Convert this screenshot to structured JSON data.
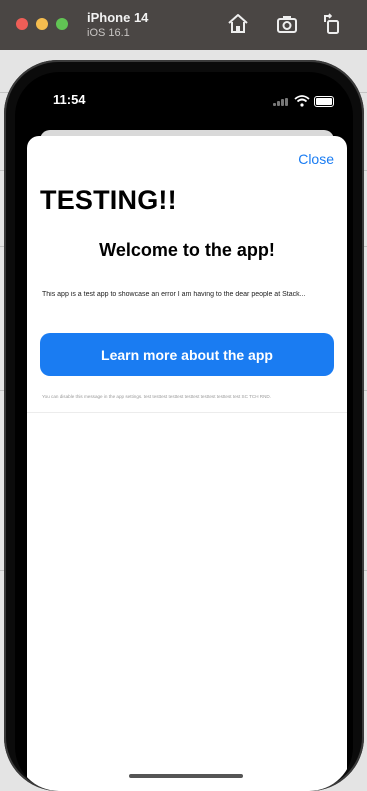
{
  "simulator": {
    "device_name": "iPhone 14",
    "os_version": "iOS 16.1",
    "toolbar_icons": [
      "home-icon",
      "screenshot-icon",
      "rotate-icon"
    ]
  },
  "status_bar": {
    "time": "11:54",
    "icons": [
      "signal-icon",
      "wifi-icon",
      "battery-icon"
    ]
  },
  "sheet": {
    "close_label": "Close",
    "heading": "TESTING!!",
    "welcome": "Welcome to the app!",
    "body": "This app is a test app to showcase an error I am having to the dear people at Stack...",
    "button_label": "Learn more about the app",
    "footnote": "You can disable this message in the app settings. test testtest testtest testtest testtest testtest test SC TCH RND."
  },
  "colors": {
    "accent": "#1a7cf2",
    "toolbar": "#4a4644"
  }
}
